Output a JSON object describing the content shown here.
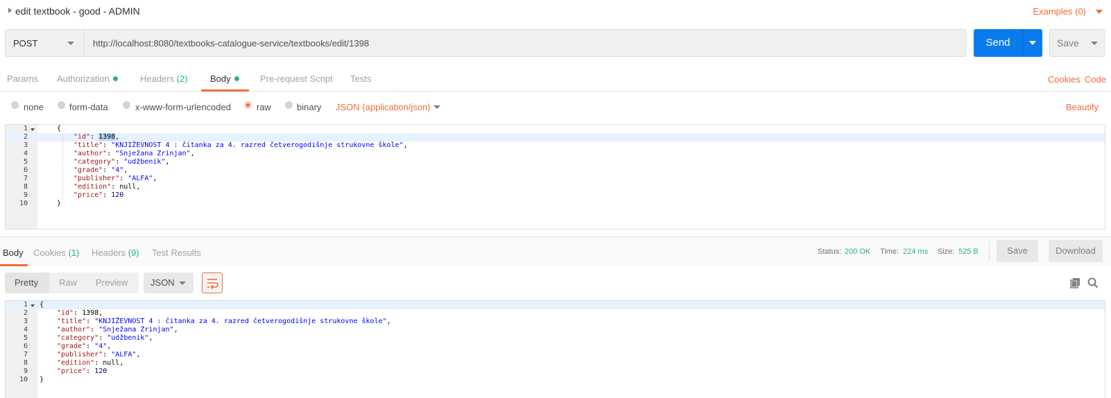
{
  "request": {
    "name": "edit textbook - good - ADMIN",
    "examples_label": "Examples (0)",
    "method": "POST",
    "url": "http://localhost:8080/textbooks-catalogue-service/textbooks/edit/1398",
    "send_label": "Send",
    "save_label": "Save"
  },
  "request_tabs": {
    "params": "Params",
    "authorization": "Authorization",
    "headers": "Headers",
    "headers_count": "(2)",
    "body": "Body",
    "prerequest": "Pre-request Script",
    "tests": "Tests",
    "cookies_link": "Cookies",
    "code_link": "Code"
  },
  "body_types": {
    "none": "none",
    "form_data": "form-data",
    "urlencoded": "x-www-form-urlencoded",
    "raw": "raw",
    "binary": "binary",
    "content_type": "JSON (application/json)",
    "selected": "raw",
    "beautify": "Beautify"
  },
  "request_body": {
    "line_numbers": [
      "1",
      "2",
      "3",
      "4",
      "5",
      "6",
      "7",
      "8",
      "9",
      "10"
    ],
    "fields": {
      "id": "1398",
      "title": "\"KNJIŽEVNOST 4 : čitanka za 4. razred četverogodišnje strukovne škole\"",
      "author": "\"Snježana Zrinjan\"",
      "category": "\"udžbenik\"",
      "grade": "\"4\"",
      "publisher": "\"ALFA\"",
      "edition": "null",
      "price": "120"
    }
  },
  "response_tabs": {
    "body": "Body",
    "cookies": "Cookies",
    "cookies_count": "(1)",
    "headers": "Headers",
    "headers_count": "(9)",
    "test_results": "Test Results"
  },
  "response_status": {
    "status_label": "Status:",
    "status_value": "200 OK",
    "time_label": "Time:",
    "time_value": "224 ms",
    "size_label": "Size:",
    "size_value": "525 B",
    "save_label": "Save",
    "download_label": "Download"
  },
  "response_view": {
    "pretty": "Pretty",
    "raw": "Raw",
    "preview": "Preview",
    "format": "JSON"
  },
  "response_body": {
    "line_numbers": [
      "1",
      "2",
      "3",
      "4",
      "5",
      "6",
      "7",
      "8",
      "9",
      "10"
    ],
    "fields": {
      "id": "1398",
      "title": "\"KNJIŽEVNOST 4 : čitanka za 4. razred četverogodišnje strukovne škole\"",
      "author": "\"Snježana Zrinjan\"",
      "category": "\"udžbenik\"",
      "grade": "\"4\"",
      "publisher": "\"ALFA\"",
      "edition": "null",
      "price": "120"
    }
  },
  "colors": {
    "accent": "#f26b3a",
    "send_blue": "#097bed",
    "success_green": "#26b47f"
  }
}
